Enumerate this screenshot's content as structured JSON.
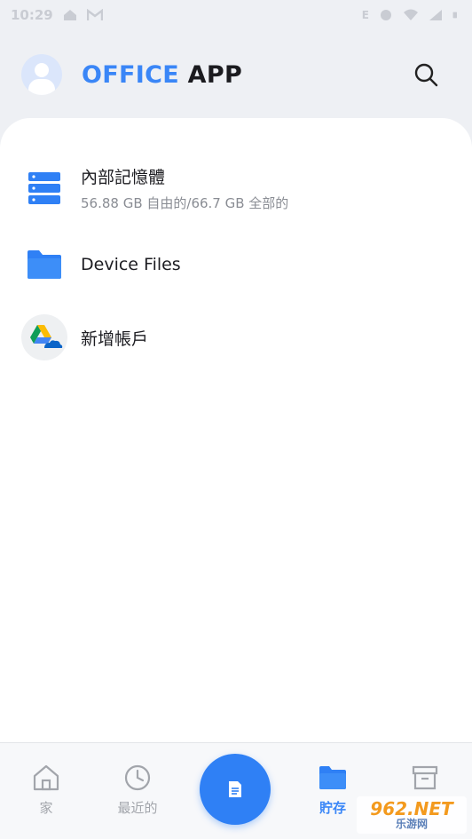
{
  "status_bar": {
    "time": "10:29",
    "network": "E"
  },
  "header": {
    "title_part1": "OFFICE",
    "title_part2": "APP"
  },
  "storage": {
    "items": [
      {
        "name": "內部記憶體",
        "detail": "56.88 GB 自由的/66.7 GB 全部的",
        "icon": "storage-server-icon"
      },
      {
        "name": "Device Files",
        "icon": "folder-icon"
      },
      {
        "name": "新增帳戶",
        "icon": "cloud-accounts-icon"
      }
    ]
  },
  "bottom_nav": {
    "items": [
      {
        "label": "家",
        "icon": "home-icon",
        "active": false
      },
      {
        "label": "最近的",
        "icon": "clock-icon",
        "active": false
      },
      {
        "label": "",
        "icon": "document-icon",
        "active": false
      },
      {
        "label": "貯存",
        "icon": "folder-icon",
        "active": true
      },
      {
        "label": "",
        "icon": "archive-icon",
        "active": false
      }
    ]
  },
  "watermark": {
    "line1": "962.NET",
    "line2": "乐游网"
  },
  "colors": {
    "accent": "#3a86f7",
    "fab": "#2f80f5",
    "background": "#eef0f4",
    "card": "#ffffff"
  }
}
